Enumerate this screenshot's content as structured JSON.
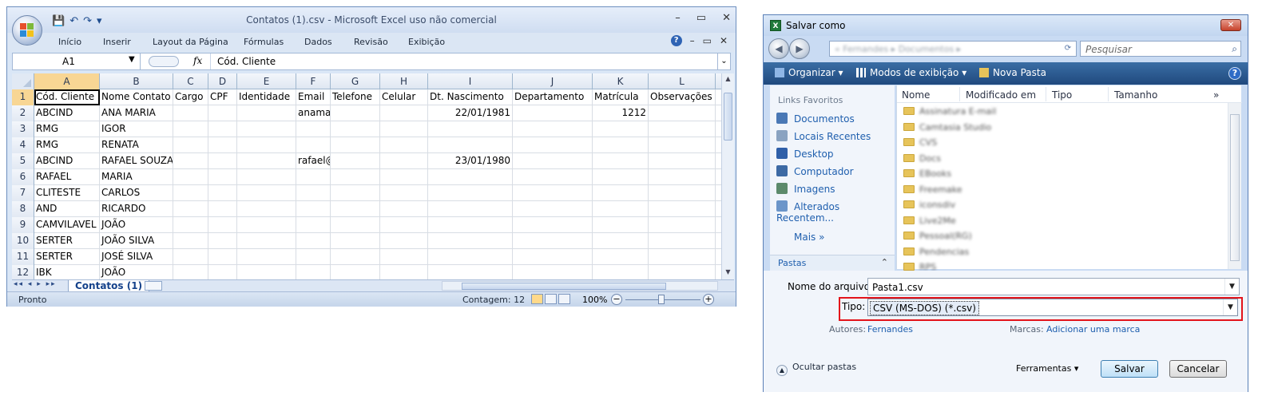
{
  "excel": {
    "title": "Contatos (1).csv - Microsoft Excel uso não comercial",
    "window_controls": [
      "–",
      "▭",
      "✕"
    ],
    "qat": [
      "💾",
      "↶",
      "↷",
      "▾"
    ],
    "ribbon_tabs": [
      "Início",
      "Inserir",
      "Layout da Página",
      "Fórmulas",
      "Dados",
      "Revisão",
      "Exibição"
    ],
    "ribbon_right": [
      "?",
      "–",
      "▭",
      "✕"
    ],
    "name_box": "A1",
    "fx_label": "fx",
    "formula": "Cód. Cliente",
    "columns": [
      "A",
      "B",
      "C",
      "D",
      "E",
      "F",
      "G",
      "H",
      "I",
      "J",
      "K",
      "L"
    ],
    "rows": [
      {
        "n": "1",
        "cells": [
          "Cód. Cliente",
          "Nome Contato",
          "Cargo",
          "CPF",
          "Identidade",
          "Email",
          "Telefone",
          "Celular",
          "Dt. Nascimento",
          "Departamento",
          "Matrícula",
          "Observações"
        ]
      },
      {
        "n": "2",
        "cells": [
          "ABCIND",
          "ANA MARIA",
          "",
          "",
          "",
          "anamaria@anamaria.com.b",
          "",
          "",
          "22/01/1981",
          "",
          "1212",
          ""
        ]
      },
      {
        "n": "3",
        "cells": [
          "RMG",
          "IGOR",
          "",
          "",
          "",
          "",
          "",
          "",
          "",
          "",
          "",
          ""
        ]
      },
      {
        "n": "4",
        "cells": [
          "RMG",
          "RENATA",
          "",
          "",
          "",
          "",
          "",
          "",
          "",
          "",
          "",
          ""
        ]
      },
      {
        "n": "5",
        "cells": [
          "ABCIND",
          "RAFAEL SOUZA",
          "",
          "",
          "",
          "rafael@abc.com.br",
          "",
          "",
          "23/01/1980",
          "",
          "",
          ""
        ]
      },
      {
        "n": "6",
        "cells": [
          "RAFAEL",
          "MARIA",
          "",
          "",
          "",
          "",
          "",
          "",
          "",
          "",
          "",
          ""
        ]
      },
      {
        "n": "7",
        "cells": [
          "CLITESTE",
          "CARLOS",
          "",
          "",
          "",
          "",
          "",
          "",
          "",
          "",
          "",
          ""
        ]
      },
      {
        "n": "8",
        "cells": [
          "AND",
          "RICARDO",
          "",
          "",
          "",
          "",
          "",
          "",
          "",
          "",
          "",
          ""
        ]
      },
      {
        "n": "9",
        "cells": [
          "CAMVILAVEL",
          "JOÃO",
          "",
          "",
          "",
          "",
          "",
          "",
          "",
          "",
          "",
          ""
        ]
      },
      {
        "n": "10",
        "cells": [
          "SERTER",
          "JOÃO SILVA",
          "",
          "",
          "",
          "",
          "",
          "",
          "",
          "",
          "",
          ""
        ]
      },
      {
        "n": "11",
        "cells": [
          "SERTER",
          "JOSÉ SILVA",
          "",
          "",
          "",
          "",
          "",
          "",
          "",
          "",
          "",
          ""
        ]
      },
      {
        "n": "12",
        "cells": [
          "IBK",
          "JOÃO",
          "",
          "",
          "",
          "",
          "",
          "",
          "",
          "",
          "",
          ""
        ]
      }
    ],
    "sheet_nav": "◂◂ ◂ ▸ ▸▸",
    "sheet_tab": "Contatos (1)",
    "status_left": "Pronto",
    "status_count": "Contagem: 12",
    "zoom": "100%",
    "zoom_minus": "−",
    "zoom_plus": "+"
  },
  "dialog": {
    "title": "Salvar como",
    "title_icon": "X",
    "close": "✕",
    "back": "◀",
    "forward": "▶",
    "address": "« Fernandes ▸ Documentos ▸",
    "search_placeholder": "Pesquisar",
    "search_icon": "⌕",
    "toolbar": {
      "organize": "Organizar ▾",
      "views": "Modos de exibição ▾",
      "new_folder": "Nova Pasta",
      "help": "?"
    },
    "favorites_header": "Links Favoritos",
    "favorites": [
      {
        "label": "Documentos",
        "color": "#4a78b5"
      },
      {
        "label": "Locais Recentes",
        "color": "#8aa3c1"
      },
      {
        "label": "Desktop",
        "color": "#2f5fa8"
      },
      {
        "label": "Computador",
        "color": "#3d6aa4"
      },
      {
        "label": "Imagens",
        "color": "#5c8a6b"
      },
      {
        "label": "Alterados Recentem...",
        "color": "#6b95c9"
      }
    ],
    "more": "Mais »",
    "folders_label": "Pastas",
    "folders_chevron": "⌃",
    "columns": [
      "Nome",
      "Modificado em",
      "Tipo",
      "Tamanho",
      "»"
    ],
    "files": [
      "Assinatura E-mail",
      "Camtasia Studio",
      "CVS",
      "Docs",
      "EBooks",
      "Freemake",
      "iconsdiv",
      "Live2Me",
      "Pessoal(RG)",
      "Pendencias",
      "RPS"
    ],
    "file_name_label": "Nome do arquivo:",
    "file_name": "Pasta1.csv",
    "type_label": "Tipo:",
    "type_value": "CSV (MS-DOS) (*.csv)",
    "authors_label": "Autores:",
    "authors_value": "Fernandes",
    "tags_label": "Marcas:",
    "tags_value": "Adicionar uma marca",
    "hide_folders": "Ocultar pastas",
    "tools": "Ferramentas ▾",
    "save": "Salvar",
    "cancel": "Cancelar"
  },
  "colors": {
    "excel_selected_header": "#f8d694",
    "highlight": "#e3141b",
    "link": "#1f5fae"
  }
}
